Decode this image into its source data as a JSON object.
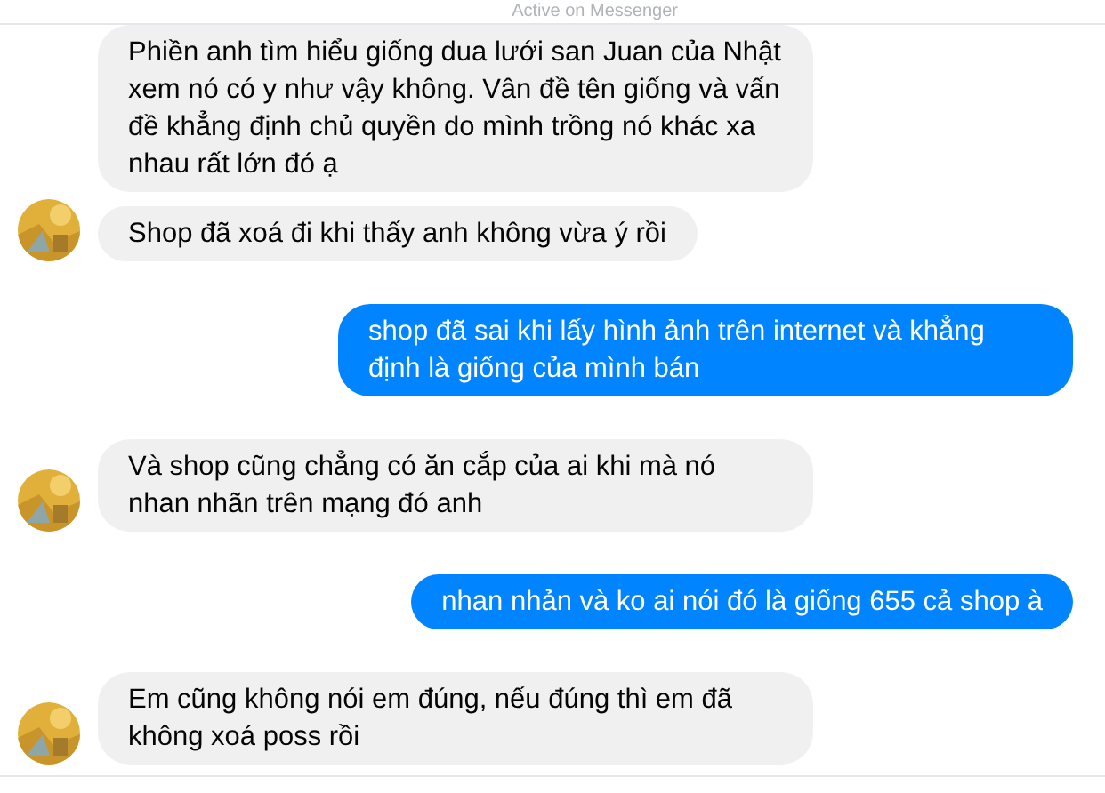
{
  "header": {
    "status": "Active on Messenger"
  },
  "messages": [
    {
      "kind": "incoming",
      "avatar": false,
      "text": "Phiền anh tìm hiểu giống dua lưới san Juan của Nhật xem nó có y như vậy không. Vân đề tên giống và vấn đề khẳng định chủ quyền do mình trồng nó khác xa nhau rất lớn đó ạ"
    },
    {
      "kind": "incoming",
      "avatar": true,
      "text": "Shop đã xoá đi khi thấy anh không vừa ý rồi"
    },
    {
      "kind": "outgoing",
      "text": "shop đã sai khi lấy hình ảnh trên internet và khẳng định là giống của mình bán"
    },
    {
      "kind": "incoming",
      "avatar": true,
      "text": "Và shop cũng chẳng có ăn cắp của ai khi mà nó nhan nhãn trên mạng đó anh"
    },
    {
      "kind": "outgoing",
      "text": "nhan nhản và ko ai nói đó là giống 655 cả shop à"
    },
    {
      "kind": "incoming",
      "avatar": true,
      "text": "Em cũng không nói em đúng, nếu đúng thì em đã không xoá poss rồi"
    }
  ]
}
